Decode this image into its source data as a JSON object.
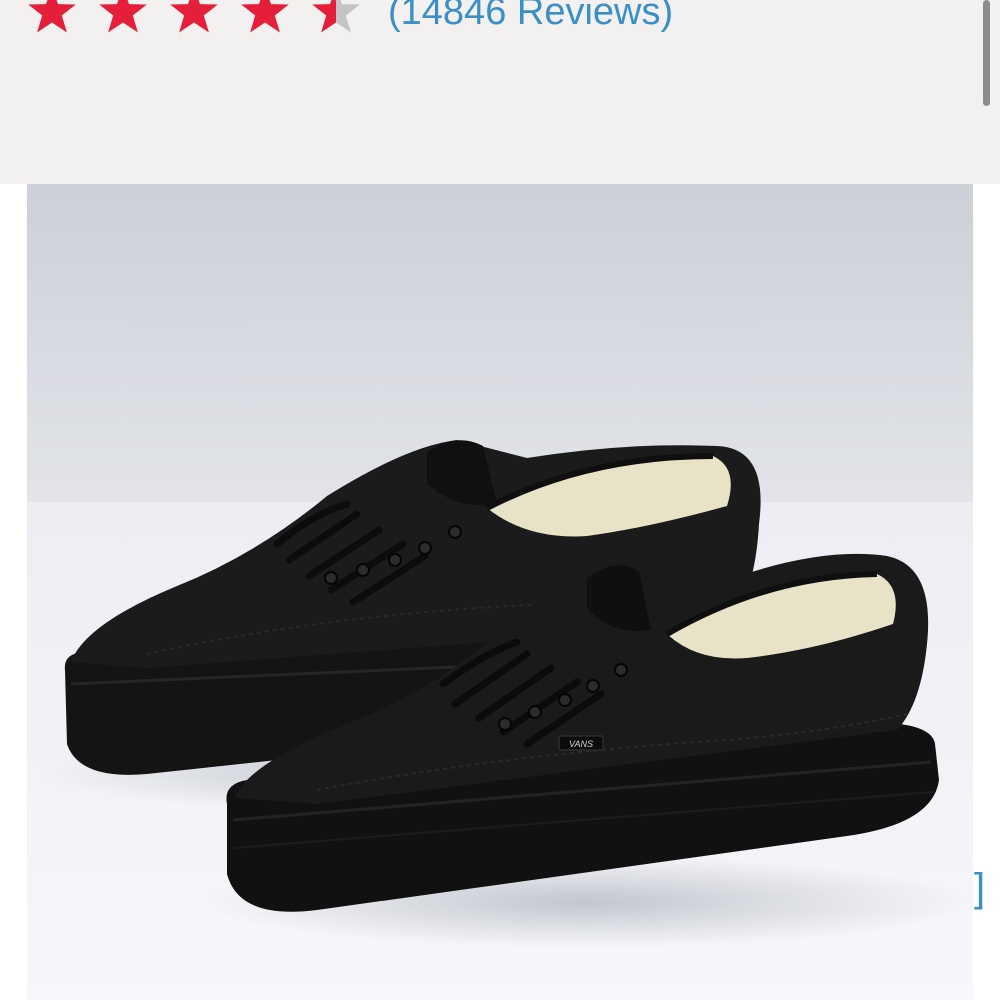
{
  "rating": {
    "value": 4.5,
    "max": 5,
    "reviews_label": "(14846 Reviews)",
    "star_color": "#e51f3a",
    "empty_star_color": "#c4c4c4"
  },
  "links": {
    "color": "#3a8fc8",
    "side_fragment": "]"
  },
  "product_image": {
    "alt": "Black canvas low-top sneakers",
    "logo_text": "VANS"
  },
  "colors": {
    "panel_background": "#f2f1ef",
    "scrollbar": "#8c8c8c"
  }
}
